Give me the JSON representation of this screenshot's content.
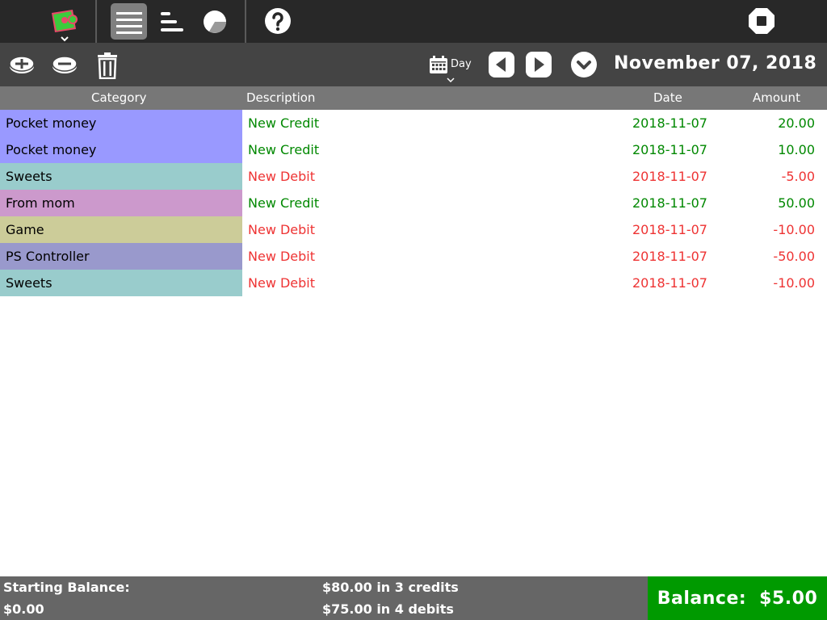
{
  "toolbar": {
    "icons": [
      "app-logo-icon",
      "list-view-icon",
      "bar-chart-icon",
      "pie-chart-icon",
      "help-icon",
      "stop-icon"
    ]
  },
  "subtoolbar": {
    "view_label": "Day",
    "date_title": "November 07, 2018"
  },
  "table": {
    "headers": {
      "category": "Category",
      "description": "Description",
      "date": "Date",
      "amount": "Amount"
    },
    "rows": [
      {
        "category": "Pocket money",
        "description": "New Credit",
        "date": "2018-11-07",
        "amount": "20.00",
        "type": "credit",
        "color": "#9999ff"
      },
      {
        "category": "Pocket money",
        "description": "New Credit",
        "date": "2018-11-07",
        "amount": "10.00",
        "type": "credit",
        "color": "#9999ff"
      },
      {
        "category": "Sweets",
        "description": "New Debit",
        "date": "2018-11-07",
        "amount": "-5.00",
        "type": "debit",
        "color": "#99cccc"
      },
      {
        "category": "From mom",
        "description": "New Credit",
        "date": "2018-11-07",
        "amount": "50.00",
        "type": "credit",
        "color": "#cc99cc"
      },
      {
        "category": "Game",
        "description": "New Debit",
        "date": "2018-11-07",
        "amount": "-10.00",
        "type": "debit",
        "color": "#cccc99"
      },
      {
        "category": "PS Controller",
        "description": "New Debit",
        "date": "2018-11-07",
        "amount": "-50.00",
        "type": "debit",
        "color": "#9999cc"
      },
      {
        "category": "Sweets",
        "description": "New Debit",
        "date": "2018-11-07",
        "amount": "-10.00",
        "type": "debit",
        "color": "#99cccc"
      }
    ]
  },
  "footer": {
    "starting_label": "Starting Balance:",
    "starting_value": "$0.00",
    "credits_summary": "$80.00 in 3 credits",
    "debits_summary": "$75.00 in 4 debits",
    "balance_label": "Balance:",
    "balance_value": "$5.00"
  },
  "colors": {
    "credit_text": "#008800",
    "debit_text": "#ee3333",
    "balance_bg": "#009a00"
  }
}
